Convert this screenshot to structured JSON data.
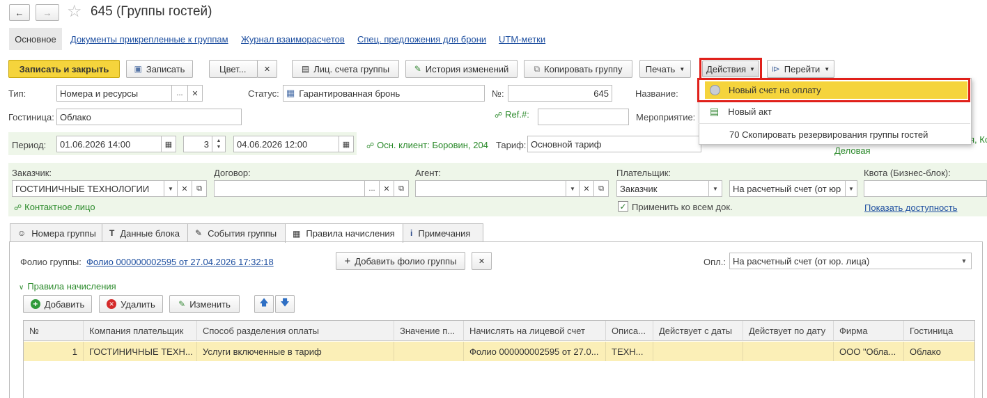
{
  "window": {
    "title": "645 (Группы гостей)"
  },
  "nav_tabs": [
    "Основное",
    "Документы прикрепленные к группам",
    "Журнал взаиморасчетов",
    "Спец. предложения для брони",
    "UTM-метки"
  ],
  "toolbar": {
    "save_close": "Записать и закрыть",
    "save": "Записать",
    "color": "Цвет...",
    "accounts": "Лиц. счета группы",
    "history": "История изменений",
    "copy_group": "Копировать группу",
    "print": "Печать",
    "actions": "Действия",
    "goto": "Перейти"
  },
  "actions_menu": [
    "Новый счет на оплату",
    "Новый акт",
    "70 Скопировать резервирования группы гостей"
  ],
  "form": {
    "type_label": "Тип:",
    "type_value": "Номера и ресурсы",
    "status_label": "Статус:",
    "status_value": "Гарантированная бронь",
    "num_label": "№:",
    "num_value": "645",
    "name_label": "Название:",
    "hotel_label": "Гостиница:",
    "hotel_value": "Облако",
    "ref_label": "Ref.#:",
    "event_label": "Мероприятие:",
    "period_label": "Период:",
    "period_from": "01.06.2026 14:00",
    "nights": "3",
    "period_to": "04.06.2026 12:00",
    "main_client": "Осн. клиент: Боровин, 204",
    "tariff_label": "Тариф:",
    "tariff_value": "Основной тариф",
    "right_clip_1": "я, Ко",
    "right_clip_2": "Деловая",
    "customer_label": "Заказчик:",
    "customer_value": "ГОСТИНИЧНЫЕ ТЕХНОЛОГИИ",
    "contract_label": "Договор:",
    "agent_label": "Агент:",
    "payer_label": "Плательщик:",
    "payer_value": "Заказчик",
    "payment_method": "На расчетный счет (от юр",
    "quota_label": "Квота (Бизнес-блок):",
    "contact_person": "Контактное лицо",
    "apply_all": "Применить ко всем док.",
    "show_availability": "Показать доступность"
  },
  "inner_tabs": [
    "Номера группы",
    "Данные блока",
    "События группы",
    "Правила начисления",
    "Примечания"
  ],
  "folio": {
    "label": "Фолио группы:",
    "link": "Фолио 000000002595 от 27.04.2026 17:32:18",
    "add_button": "Добавить фолио группы",
    "opl_label": "Опл.:",
    "opl_value": "На расчетный счет (от юр. лица)"
  },
  "rules": {
    "section_title": "Правила начисления",
    "add": "Добавить",
    "delete": "Удалить",
    "edit": "Изменить"
  },
  "table": {
    "columns": [
      "№",
      "Компания плательщик",
      "Способ разделения оплаты",
      "Значение п...",
      "Начислять на лицевой счет",
      "Описа...",
      "Действует с даты",
      "Действует по дату",
      "Фирма",
      "Гостиница"
    ],
    "rows": [
      [
        "1",
        "ГОСТИНИЧНЫЕ ТЕХН...",
        "Услуги включенные в тариф",
        "",
        "Фолио 000000002595 от 27.0...",
        "ТЕХН...",
        "",
        "",
        "ООО \"Обла...",
        "Облако"
      ]
    ]
  },
  "colors": {
    "accent_yellow": "#f5d43c",
    "highlight_red": "#e0201a",
    "link_blue": "#1e4fa0",
    "green_text": "#2b8a2b"
  }
}
